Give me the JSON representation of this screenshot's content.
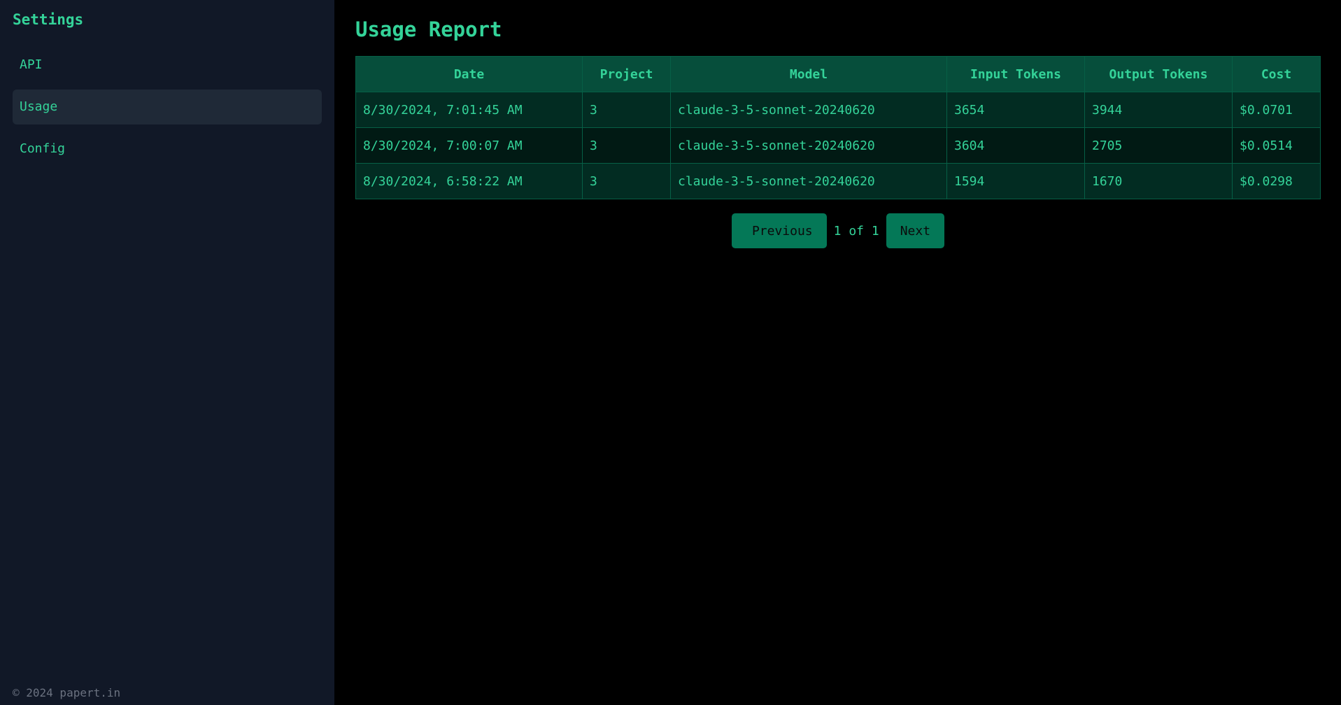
{
  "sidebar": {
    "title": "Settings",
    "items": [
      {
        "label": "API",
        "active": false
      },
      {
        "label": "Usage",
        "active": true
      },
      {
        "label": "Config",
        "active": false
      }
    ],
    "footer": "© 2024 papert.in"
  },
  "main": {
    "title": "Usage Report",
    "table": {
      "headers": [
        "Date",
        "Project",
        "Model",
        "Input Tokens",
        "Output Tokens",
        "Cost"
      ],
      "rows": [
        [
          "8/30/2024, 7:01:45 AM",
          "3",
          "claude-3-5-sonnet-20240620",
          "3654",
          "3944",
          "$0.0701"
        ],
        [
          "8/30/2024, 7:00:07 AM",
          "3",
          "claude-3-5-sonnet-20240620",
          "3604",
          "2705",
          "$0.0514"
        ],
        [
          "8/30/2024, 6:58:22 AM",
          "3",
          "claude-3-5-sonnet-20240620",
          "1594",
          "1670",
          "$0.0298"
        ]
      ]
    },
    "pagination": {
      "previous_label": "Previous",
      "page_info": "1 of 1",
      "next_label": "Next"
    }
  },
  "colors": {
    "accent": "#34d399",
    "sidebar_bg": "#111827",
    "active_item_bg": "#1f2937",
    "header_bg": "#064e3b",
    "button_bg": "#047857"
  }
}
